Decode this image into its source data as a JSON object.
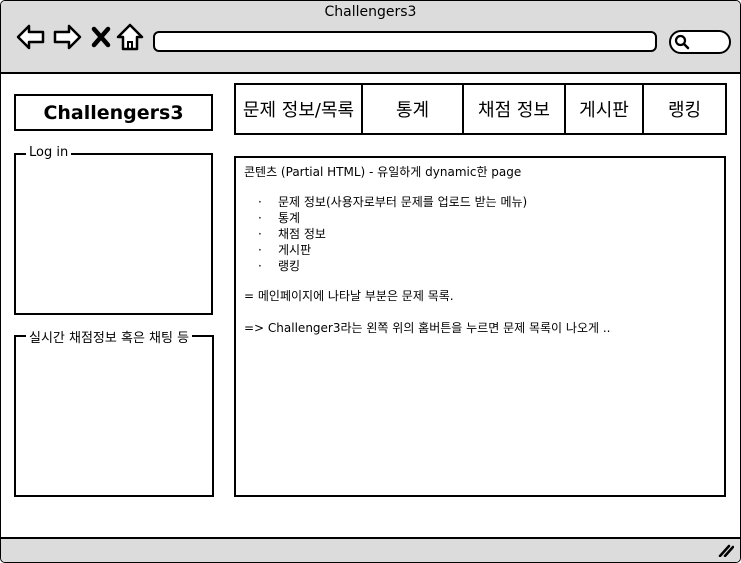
{
  "window": {
    "title": "Challengers3"
  },
  "sidebar": {
    "logo": "Challengers3",
    "login_legend": "Log in",
    "live_legend": "실시간 채점정보 혹은 채팅 등"
  },
  "tabs": [
    {
      "label": "문제 정보/목록"
    },
    {
      "label": "통계"
    },
    {
      "label": "채점 정보"
    },
    {
      "label": "게시판"
    },
    {
      "label": "랭킹"
    }
  ],
  "content": {
    "heading": "콘텐츠 (Partial HTML) - 유일하게 dynamic한 page",
    "items": [
      "문제 정보(사용자로부터 문제를 업로드 받는 메뉴)",
      "통계",
      "채점 정보",
      "게시판",
      "랭킹"
    ],
    "note1": "= 메인페이지에 나타날 부분은 문제 목록.",
    "note2": "=> Challenger3라는 왼쪽 위의 홈버튼을 누르면 문제 목록이 나오게 .."
  },
  "icons": {
    "back": "arrow-left-icon",
    "forward": "arrow-right-icon",
    "stop": "close-icon",
    "home": "home-icon",
    "search": "search-icon",
    "resize": "resize-grip-icon"
  }
}
